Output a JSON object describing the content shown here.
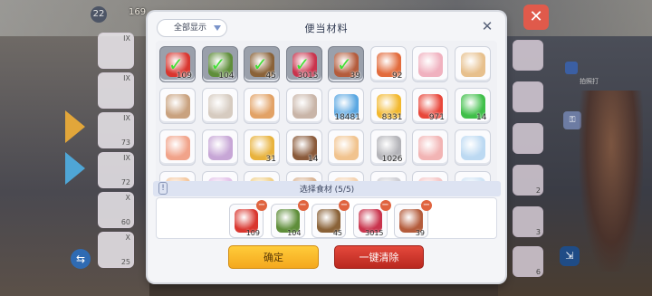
{
  "background": {
    "level": "22",
    "counter": "169",
    "left_slots": [
      {
        "q": "IX",
        "n": ""
      },
      {
        "q": "IX",
        "n": ""
      },
      {
        "q": "IX",
        "n": "73"
      },
      {
        "q": "IX",
        "n": "72"
      },
      {
        "q": "X",
        "n": "60"
      },
      {
        "q": "X",
        "n": "25"
      }
    ],
    "right_slots": [
      {
        "n": ""
      },
      {
        "n": ""
      },
      {
        "n": ""
      },
      {
        "n": "2"
      },
      {
        "n": "3"
      },
      {
        "n": "6"
      }
    ],
    "hint": "拍照打"
  },
  "dialog": {
    "title": "便当材料",
    "filter_label": "全部显示",
    "close_glyph": "✕",
    "confirm_label": "确定",
    "clear_label": "一键清除",
    "selection_label": "选择食材 (5/5)",
    "info_glyph": "!"
  },
  "grid_rows": [
    [
      {
        "name": "potion-bottle",
        "qty": "109",
        "selected": true,
        "color": "#d9362f"
      },
      {
        "name": "salad-bowl",
        "qty": "104",
        "selected": true,
        "color": "#5f8e3a"
      },
      {
        "name": "basket",
        "qty": "45",
        "selected": true,
        "color": "#8a6238"
      },
      {
        "name": "rose-cluster",
        "qty": "3015",
        "selected": true,
        "color": "#c9344d"
      },
      {
        "name": "meat-tray",
        "qty": "39",
        "selected": true,
        "color": "#b45c3c"
      },
      {
        "name": "sushi-plate",
        "qty": "92",
        "selected": false,
        "color": "#e26b3c"
      },
      {
        "name": "pink-vase",
        "qty": "",
        "selected": false,
        "color": "#f0b1bf"
      },
      {
        "name": "cake-slice",
        "qty": "",
        "selected": false,
        "color": "#e7c08d"
      }
    ],
    [
      {
        "name": "basket-pink",
        "qty": "",
        "selected": false,
        "color": "#c9a27f"
      },
      {
        "name": "flower-pot",
        "qty": "",
        "selected": false,
        "color": "#d6cbc0"
      },
      {
        "name": "wrapped-gift",
        "qty": "",
        "selected": false,
        "color": "#e2a266"
      },
      {
        "name": "dish-box",
        "qty": "",
        "selected": false,
        "color": "#c9b5a8"
      },
      {
        "name": "blue-crystal",
        "qty": "18481",
        "selected": false,
        "color": "#5aa7e2"
      },
      {
        "name": "gold-gem",
        "qty": "8331",
        "selected": false,
        "color": "#f2b82e"
      },
      {
        "name": "red-heart",
        "qty": "971",
        "selected": false,
        "color": "#e8473b"
      },
      {
        "name": "green-bolt",
        "qty": "14",
        "selected": false,
        "color": "#3fbf49"
      }
    ],
    [
      {
        "name": "bread-pink",
        "qty": "",
        "selected": false,
        "color": "#f1a38a"
      },
      {
        "name": "bread-purple",
        "qty": "",
        "selected": false,
        "color": "#c7a6d6"
      },
      {
        "name": "cheese-slice",
        "qty": "31",
        "selected": false,
        "color": "#e8b23c"
      },
      {
        "name": "chocolate-cake",
        "qty": "14",
        "selected": false,
        "color": "#8a5a3a"
      },
      {
        "name": "toast-slice",
        "qty": "",
        "selected": false,
        "color": "#f1c38e"
      },
      {
        "name": "grey-brick",
        "qty": "1026",
        "selected": false,
        "color": "#b3b3b8"
      },
      {
        "name": "pink-cube",
        "qty": "",
        "selected": false,
        "color": "#f2b4b4"
      },
      {
        "name": "ice-cube",
        "qty": "",
        "selected": false,
        "color": "#bcd9f2"
      }
    ],
    [
      {
        "name": "partial-item-1",
        "qty": "",
        "selected": false,
        "color": "#f4c8a0"
      },
      {
        "name": "partial-item-2",
        "qty": "",
        "selected": false,
        "color": "#e3c3e9"
      },
      {
        "name": "partial-item-3",
        "qty": "",
        "selected": false,
        "color": "#f0d08a"
      },
      {
        "name": "partial-item-4",
        "qty": "",
        "selected": false,
        "color": "#d9b392"
      },
      {
        "name": "partial-item-5",
        "qty": "",
        "selected": false,
        "color": "#f4d2b0"
      },
      {
        "name": "partial-item-6",
        "qty": "",
        "selected": false,
        "color": "#cdcdd3"
      },
      {
        "name": "partial-item-7",
        "qty": "",
        "selected": false,
        "color": "#f4c6c6"
      },
      {
        "name": "partial-item-8",
        "qty": "",
        "selected": false,
        "color": "#cfe3f4"
      }
    ]
  ],
  "selected_items": [
    {
      "name": "potion-bottle",
      "qty": "109",
      "color": "#d9362f"
    },
    {
      "name": "salad-bowl",
      "qty": "104",
      "color": "#5f8e3a"
    },
    {
      "name": "basket",
      "qty": "45",
      "color": "#8a6238"
    },
    {
      "name": "rose-cluster",
      "qty": "3015",
      "color": "#c9344d"
    },
    {
      "name": "meat-tray",
      "qty": "39",
      "color": "#b45c3c"
    }
  ]
}
